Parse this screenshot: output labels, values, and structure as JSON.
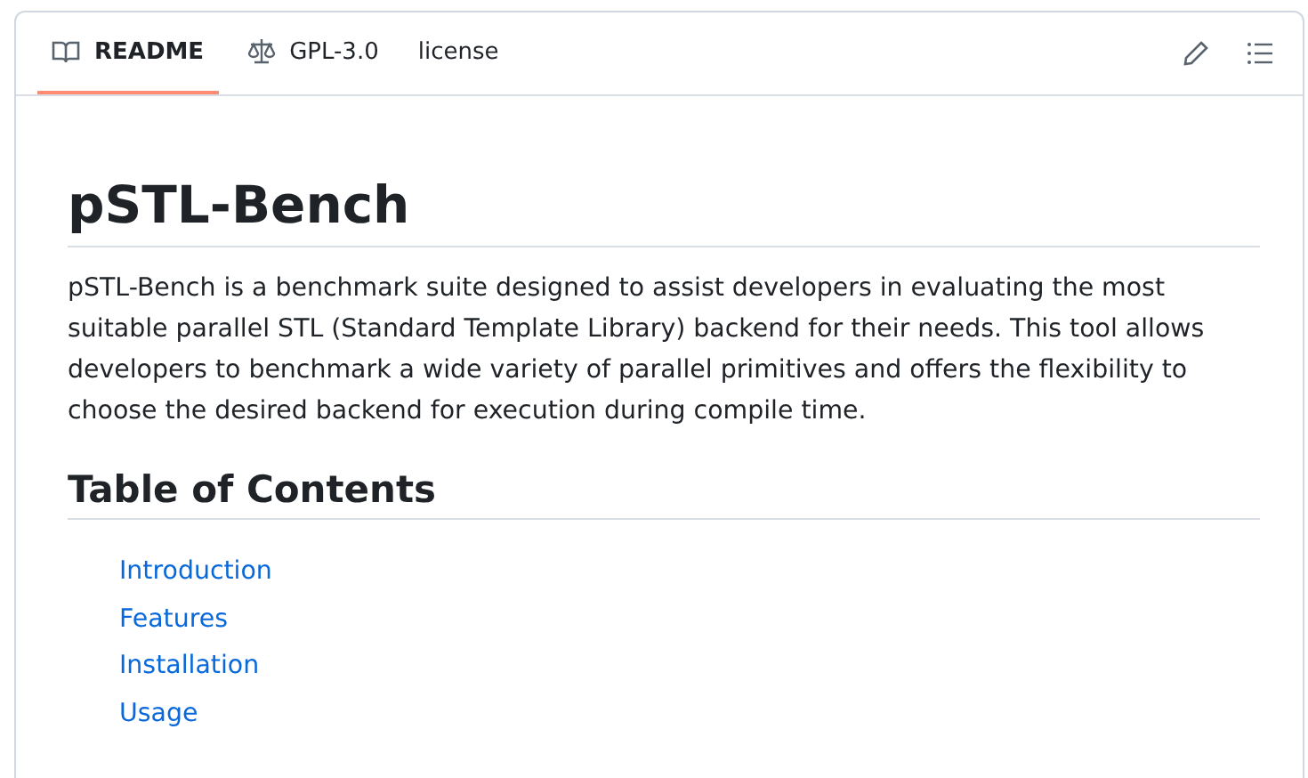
{
  "tabs": [
    {
      "kind": "readme",
      "label": "README",
      "selected": true
    },
    {
      "kind": "license",
      "label": "GPL-3.0",
      "suffix": "license",
      "selected": false
    }
  ],
  "toolbar": [
    {
      "kind": "edit"
    },
    {
      "kind": "outline"
    }
  ],
  "readme": {
    "title": "pSTL-Bench",
    "intro": "pSTL-Bench is a benchmark suite designed to assist developers in evaluating the most suitable parallel STL (Standard Template Library) backend for their needs. This tool allows developers to benchmark a wide variety of parallel primitives and offers the flexibility to choose the desired backend for execution during compile time.",
    "toc_heading": "Table of Contents",
    "toc": [
      "Introduction",
      "Features",
      "Installation",
      "Usage"
    ]
  }
}
